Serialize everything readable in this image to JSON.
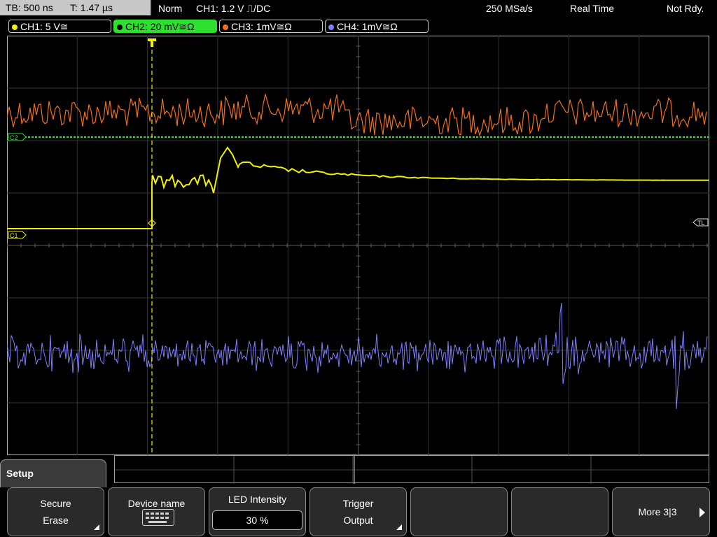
{
  "status": {
    "timebase": "TB: 500 ns",
    "trigger_time": "T: 1.47 µs",
    "mode": "Norm",
    "trigger_info": "CH1: 1.2 V ⎍/DC",
    "sample_rate": "250 MSa/s",
    "acq_mode": "Real Time",
    "state": "Not Rdy."
  },
  "channels": [
    {
      "label": "CH1: 5 V≅",
      "color": "#f0f000",
      "active": false
    },
    {
      "label": "CH2: 20 mV≅Ω",
      "color": "#2ee02e",
      "active": true
    },
    {
      "label": "CH3: 1mV≅Ω",
      "color": "#f07020",
      "active": false
    },
    {
      "label": "CH4: 1mV≅Ω",
      "color": "#8080ff",
      "active": false
    }
  ],
  "markers": {
    "ch1": "C1",
    "ch2": "C2",
    "trigger_level": "TL"
  },
  "colors": {
    "ch1": "#f0f000",
    "ch2": "#2ee02e",
    "ch3": "#f07020",
    "ch4": "#8080ff",
    "grid": "#505050"
  },
  "menu": {
    "title": "Setup",
    "keys": [
      {
        "line1": "Secure",
        "line2": "Erase"
      },
      {
        "line1": "Device name",
        "icon": "keyboard-icon"
      },
      {
        "line1": "LED Intensity",
        "value": "30 %"
      },
      {
        "line1": "Trigger",
        "line2": "Output"
      },
      {
        "line1": ""
      },
      {
        "line1": ""
      },
      {
        "line1": "More 3|3"
      }
    ]
  }
}
